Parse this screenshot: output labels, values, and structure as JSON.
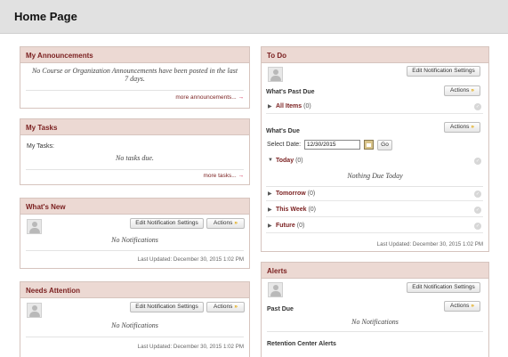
{
  "page": {
    "title": "Home Page"
  },
  "announcements": {
    "title": "My Announcements",
    "message": "No Course or Organization Announcements have been posted in the last 7 days.",
    "more_link": "more announcements...",
    "arrow": "→"
  },
  "tasks": {
    "title": "My Tasks",
    "label": "My Tasks:",
    "message": "No tasks due.",
    "more_link": "more tasks...",
    "arrow": "→"
  },
  "whats_new": {
    "title": "What's New",
    "edit_button": "Edit Notification Settings",
    "actions_button": "Actions",
    "message": "No Notifications",
    "updated": "Last Updated: December 30, 2015 1:02 PM"
  },
  "needs_attention": {
    "title": "Needs Attention",
    "edit_button": "Edit Notification Settings",
    "actions_button": "Actions",
    "message": "No Notifications",
    "updated": "Last Updated: December 30, 2015 1:02 PM"
  },
  "todo": {
    "title": "To Do",
    "edit_button": "Edit Notification Settings",
    "past_due": {
      "label": "What's Past Due",
      "actions_button": "Actions",
      "items": [
        {
          "label": "All Items",
          "count": "(0)"
        }
      ]
    },
    "due": {
      "label": "What's Due",
      "actions_button": "Actions",
      "select_date_label": "Select Date:",
      "date_value": "12/30/2015",
      "go_button": "Go",
      "today": {
        "label": "Today",
        "count": "(0)"
      },
      "today_message": "Nothing Due Today",
      "items": [
        {
          "label": "Tomorrow",
          "count": "(0)"
        },
        {
          "label": "This Week",
          "count": "(0)"
        },
        {
          "label": "Future",
          "count": "(0)"
        }
      ]
    },
    "updated": "Last Updated: December 30, 2015 1:02 PM"
  },
  "alerts": {
    "title": "Alerts",
    "edit_button": "Edit Notification Settings",
    "past_due_label": "Past Due",
    "actions_button": "Actions",
    "message": "No Notifications",
    "retention_label": "Retention Center Alerts"
  },
  "icons": {
    "chevron": "»",
    "collapsed": "▶",
    "expanded": "▼",
    "status": "✓"
  },
  "colors": {
    "header_bg": "#ecd9d3",
    "title_text": "#7a1f1f",
    "accent_chevron": "#e0a400"
  }
}
